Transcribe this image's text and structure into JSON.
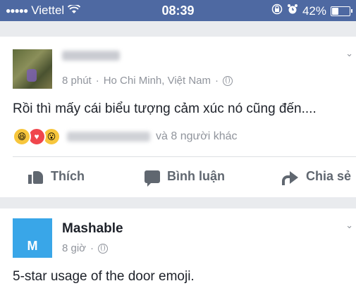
{
  "status_bar": {
    "carrier": "Viettel",
    "time": "08:39",
    "battery_percent": "42%",
    "battery_level": 0.42
  },
  "posts": [
    {
      "time": "8 phút",
      "location": "Ho Chi Minh, Việt Nam",
      "separator": "·",
      "text": "Rồi thì mấy cái biểu tượng cảm xúc nó cũng đến....",
      "reactions": [
        "haha",
        "love",
        "wow"
      ],
      "reactors_others": "và 8 người khác",
      "actions": {
        "like": "Thích",
        "comment": "Bình luận",
        "share": "Chia sẻ"
      }
    },
    {
      "author": "Mashable",
      "logo_letter": "M",
      "time": "8 giờ",
      "separator": "·",
      "text": "5-star usage of the door emoji."
    }
  ],
  "colors": {
    "status_bar": "#4e69a2",
    "background": "#e9ebee",
    "logo": "#39a6e8",
    "meta_text": "#90949c",
    "action_text": "#606770"
  }
}
